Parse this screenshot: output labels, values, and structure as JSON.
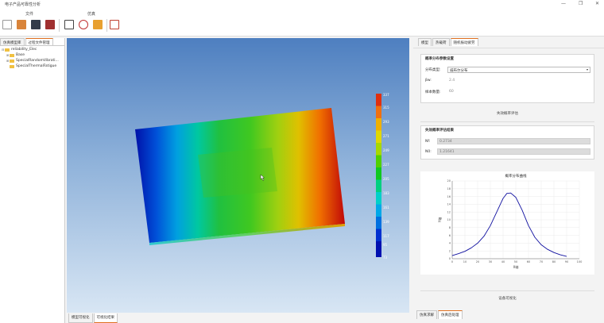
{
  "window": {
    "title": "电子产品可靠性分析"
  },
  "window_controls": {
    "minimize": "—",
    "maximize": "❐",
    "close": "✕"
  },
  "ribbon": {
    "groups": [
      {
        "label": "文件"
      },
      {
        "label": "仿真"
      }
    ]
  },
  "left_panel": {
    "tabs": [
      {
        "label": "仿真模型库"
      },
      {
        "label": "过程文件管理"
      }
    ],
    "tree": [
      {
        "label": "reliability_Elec",
        "level": 0,
        "expanded": true
      },
      {
        "label": "Base",
        "level": 1,
        "expanded": false
      },
      {
        "label": "SpecialRandomVibrati...",
        "level": 1,
        "expanded": false
      },
      {
        "label": "SpecialThermalFatigue",
        "level": 1,
        "expanded": false
      }
    ]
  },
  "viewport": {
    "legend_labels": [
      "337",
      "315",
      "293",
      "271",
      "249",
      "227",
      "205",
      "183",
      "161",
      "139",
      "117",
      "95",
      "73"
    ],
    "colors": {
      "bg_top": "#4e7fc0",
      "bg_bottom": "#d8e6f4"
    }
  },
  "bottom_tabs": [
    {
      "label": "模型可视化"
    },
    {
      "label": "可视化结果"
    }
  ],
  "right_panel": {
    "tabs": [
      {
        "label": "模型"
      },
      {
        "label": "热载荷"
      },
      {
        "label": "随机振动疲劳"
      }
    ],
    "params": {
      "title": "概率分布参数设置",
      "dist_label": "分布类型:",
      "dist_value": "威布尔分布",
      "beta_label": "βw:",
      "beta_value": "2.4",
      "samples_label": "样本数量:",
      "samples_value": "60"
    },
    "eval_action": "失效概率评估",
    "results": {
      "title": "失效概率评估结果",
      "n1_label": "Nf:",
      "n1_value": "0.2734",
      "n2_label": "N0:",
      "n2_value": "1.21641"
    },
    "chart_title": "概率分布曲线",
    "export_action": "设备可视化",
    "bottom_tabs": [
      {
        "label": "仿真求解"
      },
      {
        "label": "仿真后处理"
      }
    ]
  },
  "chart_data": {
    "type": "line",
    "title": "概率分布曲线",
    "xlabel": "X轴",
    "ylabel": "Y轴",
    "xlim": [
      0,
      100
    ],
    "ylim": [
      0,
      20
    ],
    "x_ticks": [
      0,
      10,
      20,
      30,
      40,
      50,
      60,
      70,
      80,
      90,
      100
    ],
    "y_ticks": [
      0,
      2,
      4,
      6,
      8,
      10,
      12,
      14,
      16,
      18,
      20
    ],
    "grid": true,
    "color": "#1010a0",
    "series": [
      {
        "x": [
          0,
          5,
          10,
          15,
          20,
          25,
          30,
          35,
          40,
          43,
          46,
          50,
          55,
          60,
          65,
          70,
          75,
          80,
          85,
          90
        ],
        "y": [
          0.8,
          1.3,
          1.9,
          2.8,
          4.0,
          5.8,
          8.5,
          12.0,
          15.5,
          16.8,
          16.9,
          15.8,
          12.5,
          8.5,
          5.5,
          3.6,
          2.4,
          1.6,
          1.0,
          0.6
        ]
      }
    ]
  }
}
